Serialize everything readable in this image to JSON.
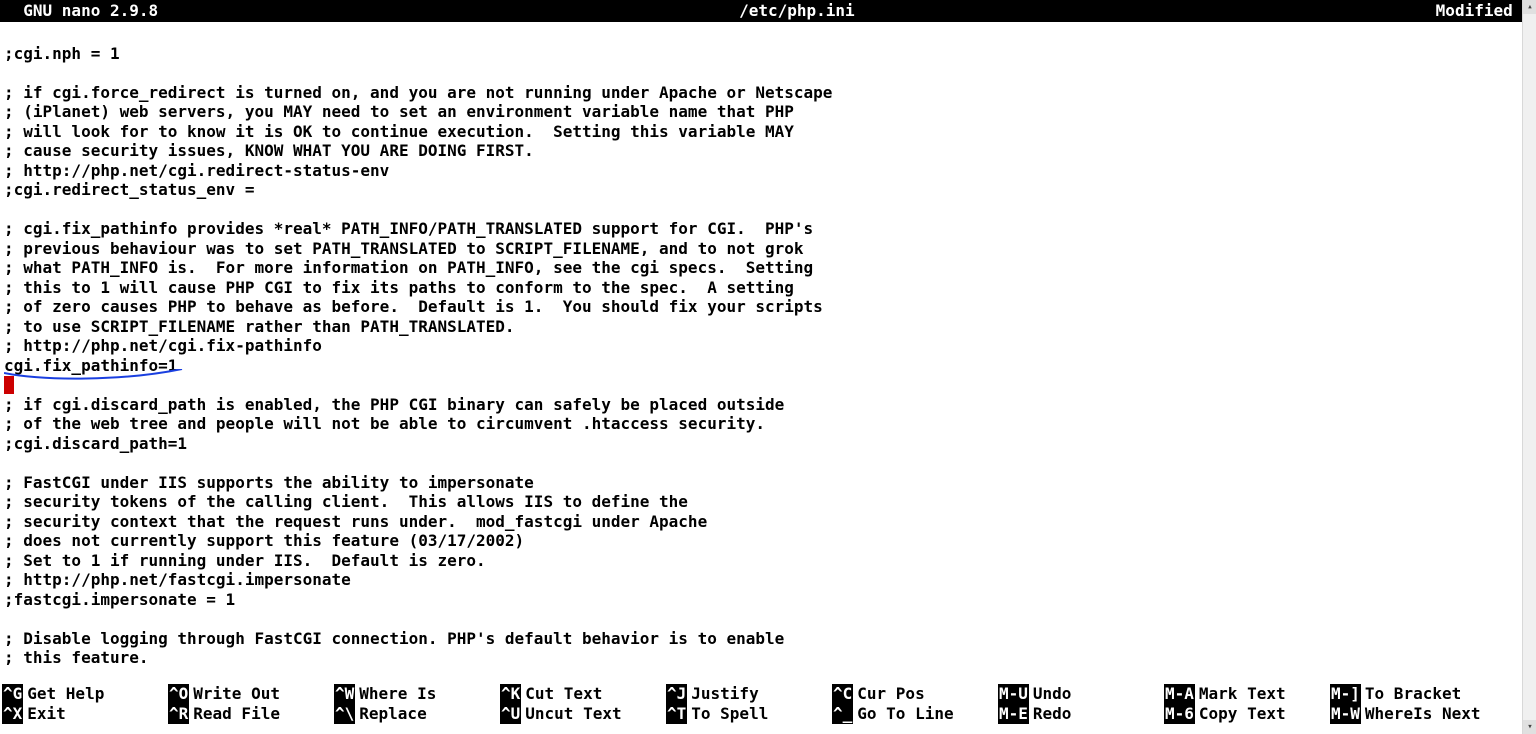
{
  "titlebar": {
    "app": "  GNU nano 2.9.8",
    "file": "/etc/php.ini",
    "status": "Modified  "
  },
  "lines": [
    "",
    ";cgi.nph = 1",
    "",
    "; if cgi.force_redirect is turned on, and you are not running under Apache or Netscape",
    "; (iPlanet) web servers, you MAY need to set an environment variable name that PHP",
    "; will look for to know it is OK to continue execution.  Setting this variable MAY",
    "; cause security issues, KNOW WHAT YOU ARE DOING FIRST.",
    "; http://php.net/cgi.redirect-status-env",
    ";cgi.redirect_status_env =",
    "",
    "; cgi.fix_pathinfo provides *real* PATH_INFO/PATH_TRANSLATED support for CGI.  PHP's",
    "; previous behaviour was to set PATH_TRANSLATED to SCRIPT_FILENAME, and to not grok",
    "; what PATH_INFO is.  For more information on PATH_INFO, see the cgi specs.  Setting",
    "; this to 1 will cause PHP CGI to fix its paths to conform to the spec.  A setting",
    "; of zero causes PHP to behave as before.  Default is 1.  You should fix your scripts",
    "; to use SCRIPT_FILENAME rather than PATH_TRANSLATED.",
    "; http://php.net/cgi.fix-pathinfo",
    "cgi.fix_pathinfo=1",
    "",
    "; if cgi.discard_path is enabled, the PHP CGI binary can safely be placed outside",
    "; of the web tree and people will not be able to circumvent .htaccess security.",
    ";cgi.discard_path=1",
    "",
    "; FastCGI under IIS supports the ability to impersonate",
    "; security tokens of the calling client.  This allows IIS to define the",
    "; security context that the request runs under.  mod_fastcgi under Apache",
    "; does not currently support this feature (03/17/2002)",
    "; Set to 1 if running under IIS.  Default is zero.",
    "; http://php.net/fastcgi.impersonate",
    ";fastcgi.impersonate = 1",
    "",
    "; Disable logging through FastCGI connection. PHP's default behavior is to enable",
    "; this feature."
  ],
  "cursor_line_index": 18,
  "shortcuts": {
    "row1": [
      {
        "key": "^G",
        "label": "Get Help"
      },
      {
        "key": "^O",
        "label": "Write Out"
      },
      {
        "key": "^W",
        "label": "Where Is"
      },
      {
        "key": "^K",
        "label": "Cut Text"
      },
      {
        "key": "^J",
        "label": "Justify"
      },
      {
        "key": "^C",
        "label": "Cur Pos"
      },
      {
        "key": "M-U",
        "label": "Undo"
      },
      {
        "key": "M-A",
        "label": "Mark Text"
      },
      {
        "key": "M-]",
        "label": "To Bracket"
      }
    ],
    "row2": [
      {
        "key": "^X",
        "label": "Exit"
      },
      {
        "key": "^R",
        "label": "Read File"
      },
      {
        "key": "^\\",
        "label": "Replace"
      },
      {
        "key": "^U",
        "label": "Uncut Text"
      },
      {
        "key": "^T",
        "label": "To Spell"
      },
      {
        "key": "^_",
        "label": "Go To Line"
      },
      {
        "key": "M-E",
        "label": "Redo"
      },
      {
        "key": "M-6",
        "label": "Copy Text"
      },
      {
        "key": "M-W",
        "label": "WhereIs Next"
      }
    ]
  }
}
